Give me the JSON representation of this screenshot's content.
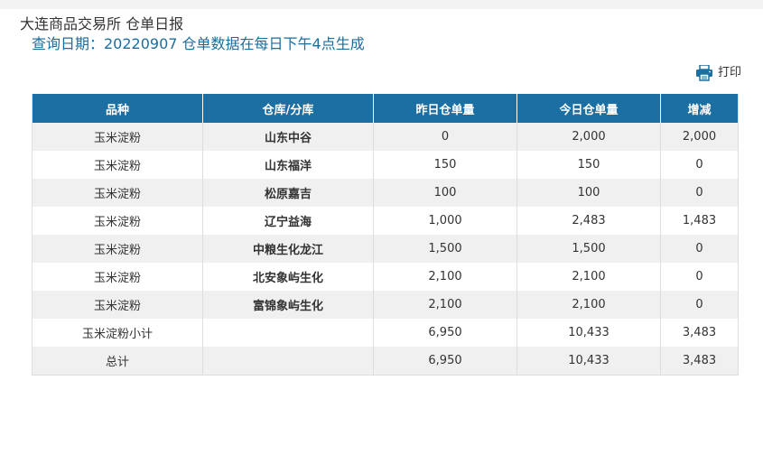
{
  "header": {
    "title": "大连商品交易所 仓单日报",
    "subtitle": "查询日期：20220907 仓单数据在每日下午4点生成"
  },
  "toolbar": {
    "print_label": "打印",
    "print_icon": "printer-icon"
  },
  "colors": {
    "header_bg": "#1b6fa3",
    "subtitle_text": "#1a6e9e",
    "row_alt_bg": "#f0f0f0"
  },
  "table": {
    "columns": [
      "品种",
      "仓库/分库",
      "昨日仓单量",
      "今日仓单量",
      "增减"
    ],
    "rows": [
      {
        "variety": "玉米淀粉",
        "warehouse": "山东中谷",
        "yesterday": "0",
        "today": "2,000",
        "change": "2,000"
      },
      {
        "variety": "玉米淀粉",
        "warehouse": "山东福洋",
        "yesterday": "150",
        "today": "150",
        "change": "0"
      },
      {
        "variety": "玉米淀粉",
        "warehouse": "松原嘉吉",
        "yesterday": "100",
        "today": "100",
        "change": "0"
      },
      {
        "variety": "玉米淀粉",
        "warehouse": "辽宁益海",
        "yesterday": "1,000",
        "today": "2,483",
        "change": "1,483"
      },
      {
        "variety": "玉米淀粉",
        "warehouse": "中粮生化龙江",
        "yesterday": "1,500",
        "today": "1,500",
        "change": "0"
      },
      {
        "variety": "玉米淀粉",
        "warehouse": "北安象屿生化",
        "yesterday": "2,100",
        "today": "2,100",
        "change": "0"
      },
      {
        "variety": "玉米淀粉",
        "warehouse": "富锦象屿生化",
        "yesterday": "2,100",
        "today": "2,100",
        "change": "0"
      },
      {
        "variety": "玉米淀粉小计",
        "warehouse": "",
        "yesterday": "6,950",
        "today": "10,433",
        "change": "3,483"
      },
      {
        "variety": "总计",
        "warehouse": "",
        "yesterday": "6,950",
        "today": "10,433",
        "change": "3,483"
      }
    ]
  }
}
